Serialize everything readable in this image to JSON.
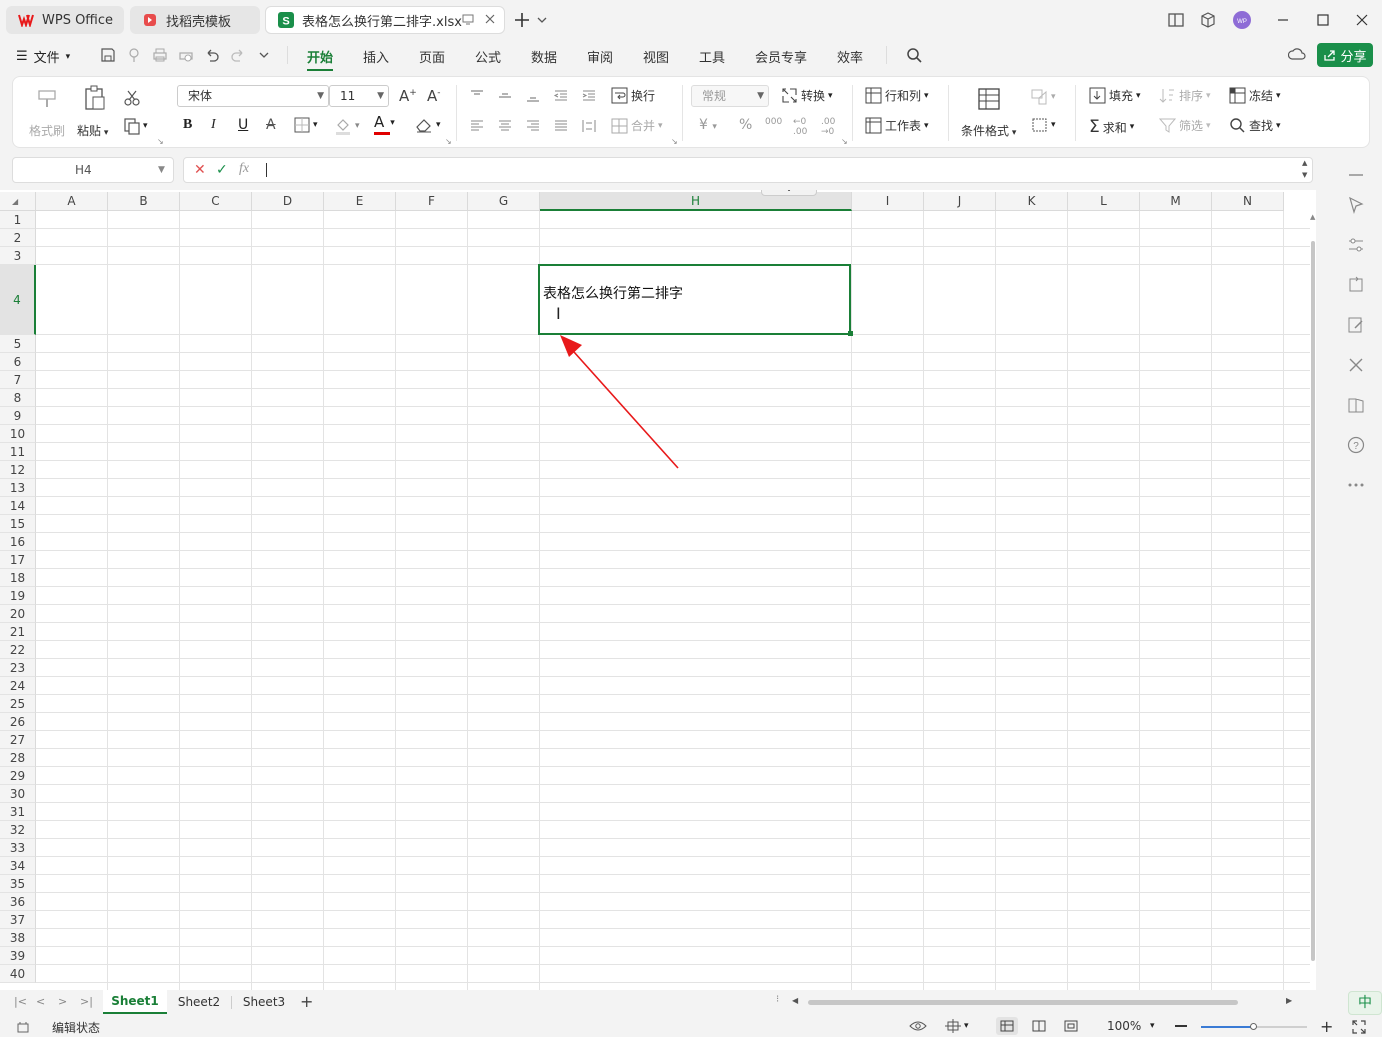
{
  "tabs": [
    {
      "label": "WPS Office"
    },
    {
      "label": "找稻壳模板"
    },
    {
      "label": "表格怎么换行第二排字.xlsx"
    }
  ],
  "menu": {
    "file": "文件",
    "tabs": [
      "开始",
      "插入",
      "页面",
      "公式",
      "数据",
      "审阅",
      "视图",
      "工具",
      "会员专享",
      "效率"
    ],
    "share": "分享"
  },
  "ribbon": {
    "format_painter": "格式刷",
    "paste": "粘贴",
    "font_name": "宋体",
    "font_size": "11",
    "wrap": "换行",
    "merge": "合并",
    "number_format": "常规",
    "convert": "转换",
    "row_col": "行和列",
    "worksheet": "工作表",
    "cond_format": "条件格式",
    "fill": "填充",
    "sort": "排序",
    "freeze": "冻结",
    "sum": "求和",
    "filter": "筛选",
    "find": "查找"
  },
  "formula_bar": {
    "cell_ref": "H4",
    "fx": "fx",
    "value": ""
  },
  "grid": {
    "columns": [
      "A",
      "B",
      "C",
      "D",
      "E",
      "F",
      "G",
      "H",
      "I",
      "J",
      "K",
      "L",
      "M",
      "N"
    ],
    "selected_column": "H",
    "rows": [
      "1",
      "2",
      "3",
      "4",
      "5",
      "6",
      "7",
      "8",
      "9",
      "10",
      "11",
      "12",
      "13",
      "14",
      "15",
      "16",
      "17",
      "18",
      "19",
      "20",
      "21",
      "22",
      "23",
      "24",
      "25",
      "26",
      "27",
      "28",
      "29",
      "30",
      "31",
      "32",
      "33",
      "34",
      "35",
      "36",
      "37",
      "38",
      "39",
      "40"
    ],
    "selected_row": "4",
    "active_cell_text": "表格怎么换行第二排字"
  },
  "sheets": [
    "Sheet1",
    "Sheet2",
    "Sheet3"
  ],
  "active_sheet": "Sheet1",
  "status": {
    "mode": "编辑状态",
    "zoom": "100%",
    "ime": "中"
  },
  "colors": {
    "accent": "#1a7f37",
    "arrow": "#e8191a",
    "font_color": "#e00000"
  }
}
